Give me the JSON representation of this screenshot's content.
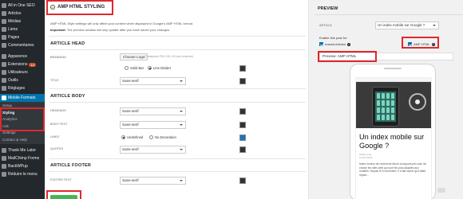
{
  "sidebar": {
    "items": [
      {
        "label": "All in One SEO",
        "icon": "seo-icon"
      },
      {
        "label": "Articles",
        "icon": "pin-icon"
      },
      {
        "label": "Médias",
        "icon": "media-icon"
      },
      {
        "label": "Liens",
        "icon": "link-icon"
      },
      {
        "label": "Pages",
        "icon": "page-icon"
      },
      {
        "label": "Commentaires",
        "icon": "comment-icon"
      },
      {
        "label": "Apparence",
        "icon": "brush-icon"
      },
      {
        "label": "Extensions",
        "icon": "plugin-icon",
        "badge": "14"
      },
      {
        "label": "Utilisateurs",
        "icon": "users-icon"
      },
      {
        "label": "Outils",
        "icon": "wrench-icon"
      },
      {
        "label": "Réglages",
        "icon": "settings-icon"
      }
    ],
    "active": {
      "label": "Mobile Formats",
      "icon": "mobile-icon"
    },
    "submenu": [
      "Setup",
      "Styling",
      "Analytics",
      "Ads",
      "Settings",
      "Contact & Help"
    ],
    "submenu_current": "Styling",
    "bottom_items": [
      {
        "label": "Thank Me Later",
        "icon": "heart-icon"
      },
      {
        "label": "MailChimp Forms",
        "icon": "mail-icon"
      },
      {
        "label": "BackWPup",
        "icon": "backup-icon"
      },
      {
        "label": "Réduire le menu",
        "icon": "collapse-icon"
      }
    ]
  },
  "main": {
    "title": "AMP HTML STYLING",
    "intro_line": "AMP HTML Style settings will only affect your content when displayed in Google's AMP HTML format.",
    "important_label": "Important:",
    "important_text": " The preview window will only update after you have saved your changes.",
    "sections": {
      "head": "ARTICLE HEAD",
      "body": "ARTICLE BODY",
      "footer": "ARTICLE FOOTER"
    },
    "branding_label": "BRANDING",
    "choose_logo": "Choose Logo",
    "logo_hint": "(Transparent PNG 160 x 50 pixel minimum)",
    "solid_bar": "Solid Bar",
    "line_divider": "Line Divider",
    "title_label": "TITLE",
    "title_font": "Sans-serif",
    "headings_label": "HEADINGS",
    "headings_font": "Sans-serif",
    "body_text_label": "BODY TEXT",
    "body_text_font": "Sans-serif",
    "links_label": "LINKS",
    "underlined": "Underlined",
    "no_decoration": "No Decoration",
    "quotes_label": "QUOTES",
    "quotes_font": "Sans-serif",
    "footer_text_label": "FOOTER TEXT",
    "footer_text_font": "Sans-serif"
  },
  "preview": {
    "title": "PREVIEW",
    "article_label": "ARTICLE",
    "article_value": "Un index mobile sur Google ?",
    "enable_label": "Enable this post for:",
    "instant_articles": "Instant Articles",
    "amp_html": "AMP HTML",
    "mode_bar": "Preview: AMP HTML",
    "article_title": "Un index mobile sur Google ?",
    "author": "Hélène Lau",
    "date": "4 OCT 2016",
    "excerpt": "Notre moteur de recherche favori a toujours pris soin de choisir les sites web qui sont les plus adaptés aux mobiles. Depuis le 5 novembre, il a fait savoir qu'il allait rejoint..."
  },
  "colors": {
    "accent": "#0073aa",
    "annotation": "#e0282e",
    "link_swatch": "#1e73be",
    "save_button": "#46b450"
  }
}
